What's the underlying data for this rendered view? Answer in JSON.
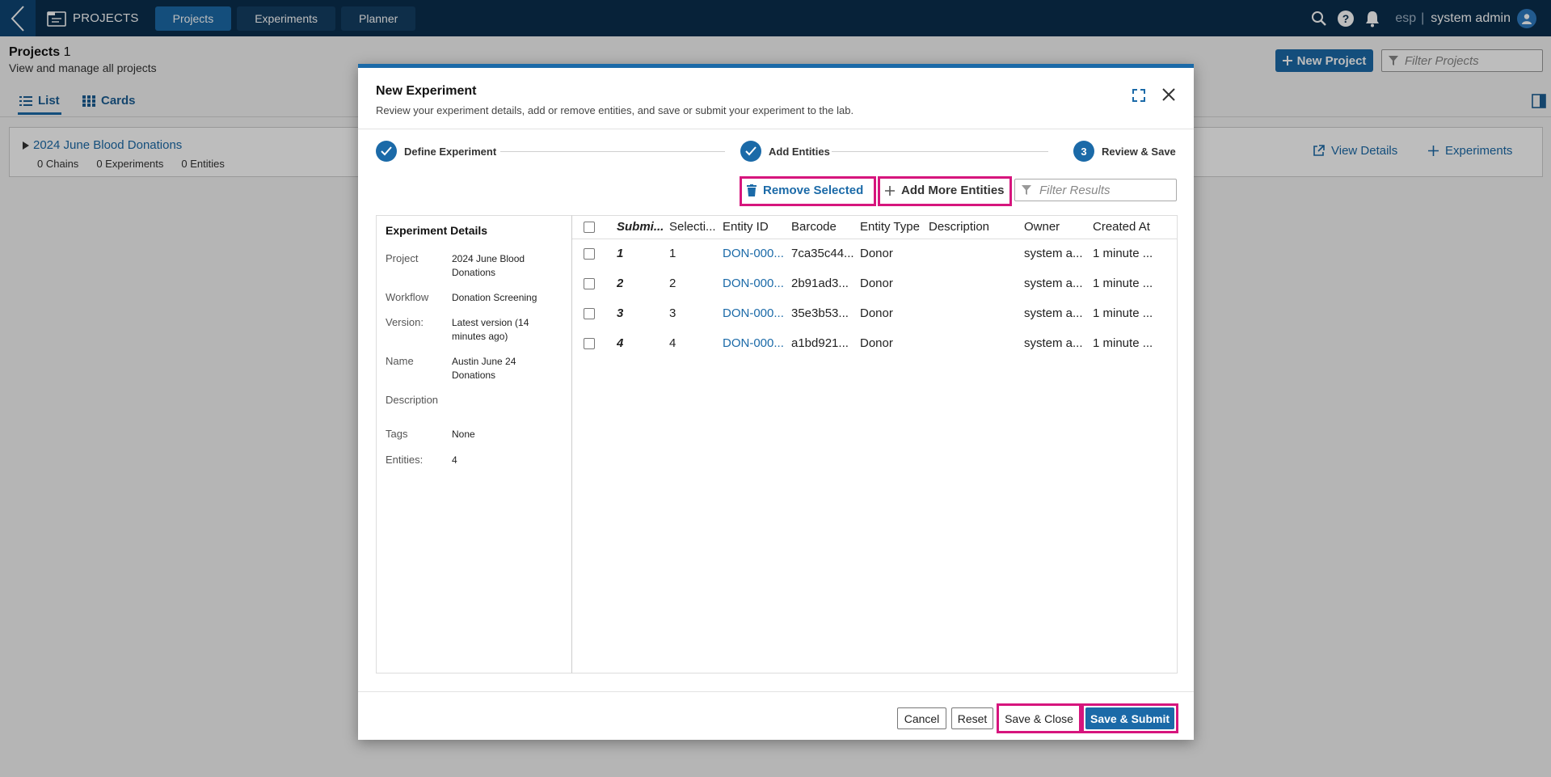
{
  "topbar": {
    "app_title": "PROJECTS",
    "tabs": [
      {
        "label": "Projects",
        "active": true
      },
      {
        "label": "Experiments",
        "active": false
      },
      {
        "label": "Planner",
        "active": false
      }
    ],
    "env": "esp",
    "separator": "|",
    "user": "system admin"
  },
  "page": {
    "title": "Projects",
    "count": "1",
    "subtitle": "View and manage all projects",
    "new_project_label": "New Project",
    "filter_placeholder": "Filter Projects",
    "view_tabs": [
      {
        "label": "List",
        "active": true
      },
      {
        "label": "Cards",
        "active": false
      }
    ],
    "project": {
      "name": "2024 June Blood Donations",
      "stats": [
        "0 Chains",
        "0 Experiments",
        "0 Entities"
      ],
      "actions": [
        "View Details",
        "Experiments"
      ]
    }
  },
  "modal": {
    "title": "New Experiment",
    "subtitle": "Review your experiment details, add or remove entities, and save or submit your experiment to the lab.",
    "steps": [
      {
        "label": "Define Experiment",
        "done": true
      },
      {
        "label": "Add Entities",
        "done": true
      },
      {
        "label": "Review & Save",
        "number": "3",
        "current": true
      }
    ],
    "toolbar": {
      "remove_label": "Remove Selected",
      "add_label": "Add More Entities",
      "filter_placeholder": "Filter Results"
    },
    "details": {
      "title": "Experiment Details",
      "rows": [
        {
          "label": "Project",
          "value": "2024 June Blood Donations"
        },
        {
          "label": "Workflow",
          "value": "Donation Screening"
        },
        {
          "label": "Version:",
          "value": "Latest version (14 minutes ago)"
        },
        {
          "label": "Name",
          "value": "Austin June 24 Donations"
        },
        {
          "label": "Description",
          "value": ""
        },
        {
          "label": "Tags",
          "value": "None"
        },
        {
          "label": "Entities:",
          "value": "4"
        }
      ]
    },
    "grid": {
      "columns": [
        "Submi...",
        "Selecti...",
        "Entity ID",
        "Barcode",
        "Entity Type",
        "Description",
        "Owner",
        "Created At"
      ],
      "rows": [
        {
          "submit": "1",
          "selection": "1",
          "entity_id": "DON-000...",
          "barcode": "7ca35c44...",
          "type": "Donor",
          "description": "",
          "owner": "system a...",
          "created": "1 minute ..."
        },
        {
          "submit": "2",
          "selection": "2",
          "entity_id": "DON-000...",
          "barcode": "2b91ad3...",
          "type": "Donor",
          "description": "",
          "owner": "system a...",
          "created": "1 minute ..."
        },
        {
          "submit": "3",
          "selection": "3",
          "entity_id": "DON-000...",
          "barcode": "35e3b53...",
          "type": "Donor",
          "description": "",
          "owner": "system a...",
          "created": "1 minute ..."
        },
        {
          "submit": "4",
          "selection": "4",
          "entity_id": "DON-000...",
          "barcode": "a1bd921...",
          "type": "Donor",
          "description": "",
          "owner": "system a...",
          "created": "1 minute ..."
        }
      ]
    },
    "footer": {
      "cancel": "Cancel",
      "reset": "Reset",
      "save_close": "Save & Close",
      "save_submit": "Save & Submit"
    }
  },
  "colors": {
    "topbar": "#0a2f4e",
    "accent": "#1b6aa8",
    "highlight": "#d6157d"
  },
  "icons": [
    "back-chevron-icon",
    "projects-app-icon",
    "search-icon",
    "help-icon",
    "bell-icon",
    "user-avatar-icon",
    "plus-icon",
    "filter-icon",
    "list-icon",
    "grid-icon",
    "panel-toggle-icon",
    "caret-right-icon",
    "external-link-icon",
    "expand-icon",
    "close-icon",
    "check-icon",
    "trash-icon"
  ]
}
